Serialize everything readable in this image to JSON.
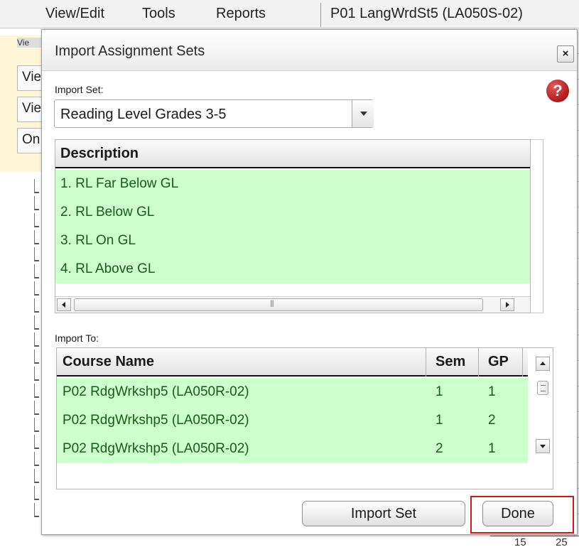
{
  "menubar": {
    "items": [
      "View/Edit",
      "Tools",
      "Reports"
    ],
    "current_course": "P01  LangWrdSt5 (LA050S-02)"
  },
  "background": {
    "tab_label": "Vie",
    "buttons": [
      "Vie",
      "Vie",
      "On"
    ],
    "bottom_values": [
      "15",
      "25"
    ]
  },
  "dialog": {
    "title": "Import Assignment Sets",
    "close_label": "×",
    "help_label": "?",
    "import_set": {
      "label": "Import Set:",
      "selected": "Reading Level Grades 3-5"
    },
    "description_grid": {
      "header": "Description",
      "rows": [
        "1. RL Far Below GL",
        "2. RL Below GL",
        "3. RL On GL",
        "4. RL Above GL"
      ]
    },
    "import_to": {
      "label": "Import To:",
      "columns": [
        "Course Name",
        "Sem",
        "GP"
      ],
      "rows": [
        {
          "course": "P02  RdgWrkshp5 (LA050R-02)",
          "sem": "1",
          "gp": "1"
        },
        {
          "course": "P02  RdgWrkshp5 (LA050R-02)",
          "sem": "1",
          "gp": "2"
        },
        {
          "course": "P02  RdgWrkshp5 (LA050R-02)",
          "sem": "2",
          "gp": "1"
        }
      ]
    },
    "buttons": {
      "import_set": "Import Set",
      "done": "Done"
    }
  },
  "colors": {
    "row_background": "#ccffcc",
    "row_text": "#1a5a1a",
    "help_icon": "#c0272d",
    "highlight": "#d01818"
  }
}
